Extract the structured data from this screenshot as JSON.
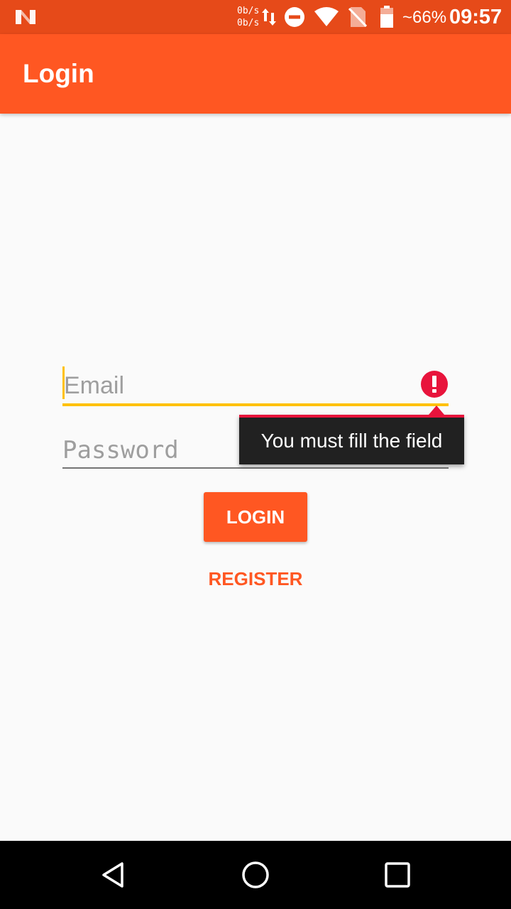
{
  "status_bar": {
    "net_speed_up": "0b/s",
    "net_speed_down": "0b/s",
    "battery_percent": "~66%",
    "time": "09:57",
    "icons": [
      "n-logo-icon",
      "data-transfer-icon",
      "do-not-disturb-icon",
      "wifi-icon",
      "no-sim-icon",
      "battery-icon"
    ]
  },
  "app_bar": {
    "title": "Login"
  },
  "form": {
    "email": {
      "placeholder": "Email",
      "value": "",
      "error": "You must fill the field",
      "error_icon": "error-icon"
    },
    "password": {
      "placeholder": "Password",
      "value": ""
    },
    "login_label": "LOGIN",
    "register_label": "REGISTER"
  },
  "nav_bar": {
    "icons": [
      "back-icon",
      "home-icon",
      "recents-icon"
    ]
  },
  "colors": {
    "status_bar": "#e64a19",
    "primary": "#ff5722",
    "accent": "#ffc107",
    "error": "#e8143c",
    "background": "#fafafa"
  }
}
